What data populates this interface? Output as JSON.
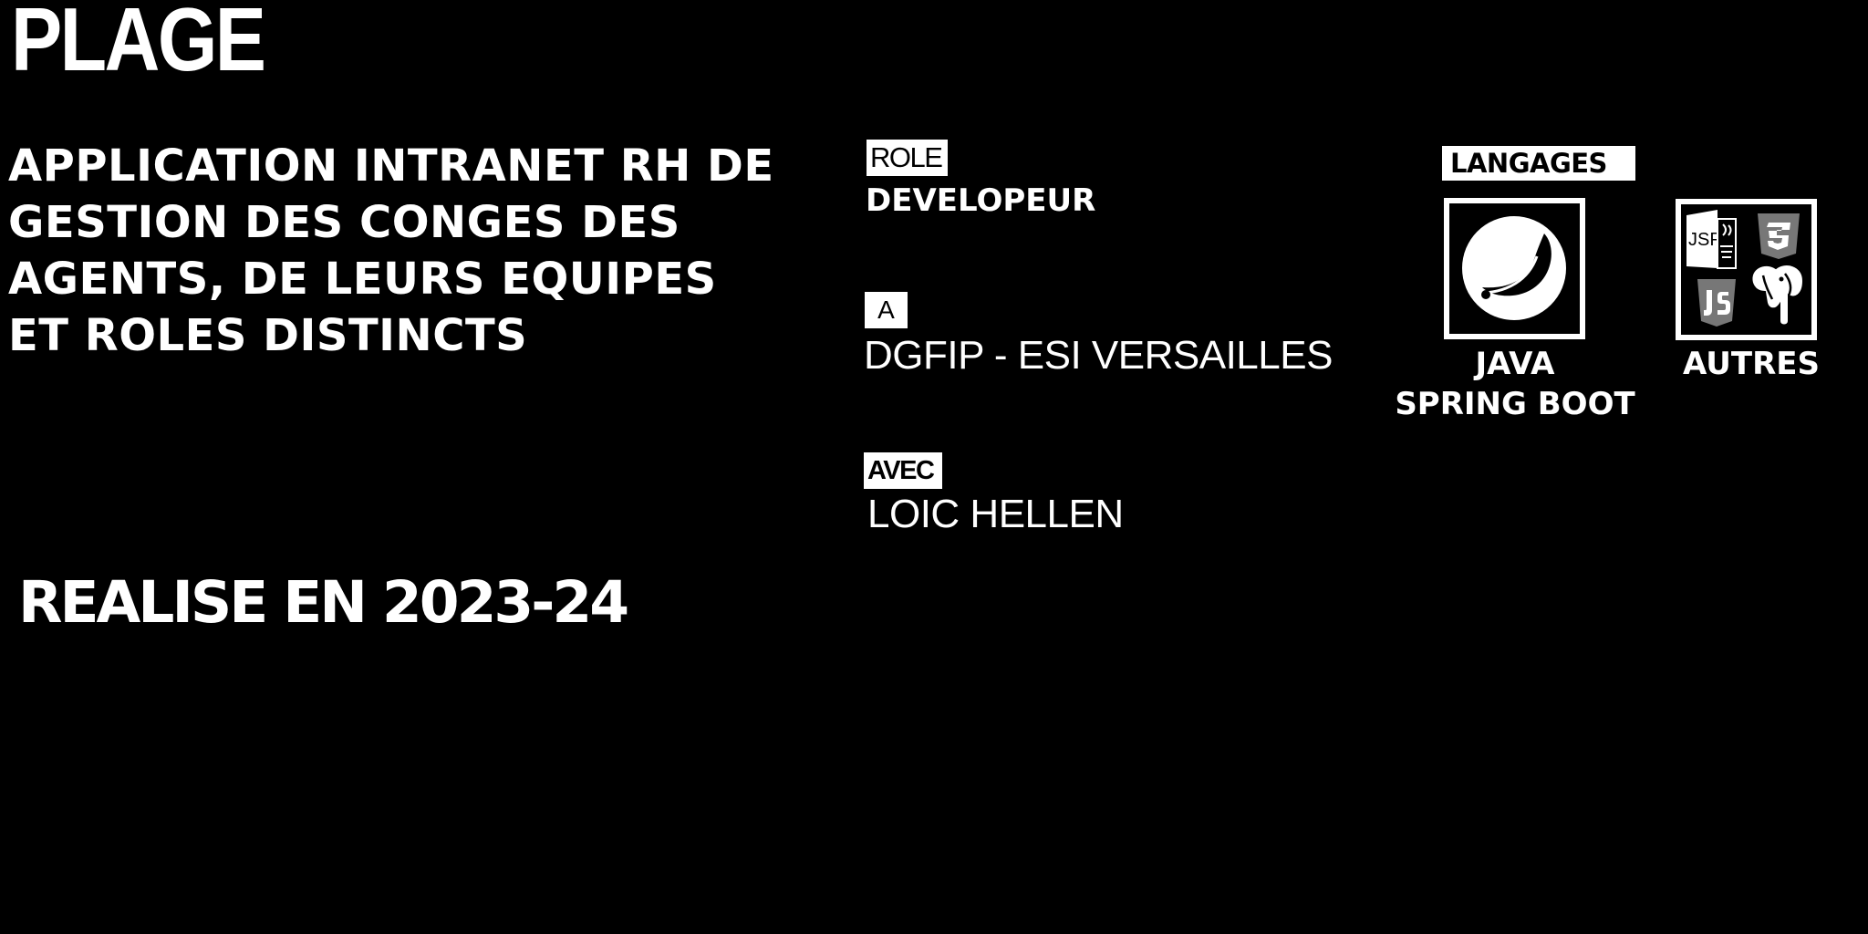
{
  "title": "PLAGE",
  "description": {
    "lines": [
      "APPLICATION INTRANET RH DE",
      "GESTION DES CONGES DES",
      "AGENTS, DE LEURS EQUIPES",
      "ET ROLES DISTINCTS"
    ]
  },
  "year_text": "REALISE EN 2023-24",
  "role": {
    "label": "ROLE",
    "value": "DEVELOPEUR"
  },
  "location": {
    "label": "A",
    "value": "DGFIP - ESI VERSAILLES"
  },
  "partner": {
    "label": "AVEC",
    "value": "LOIC HELLEN"
  },
  "languages": {
    "label": "LANGAGES",
    "items": [
      {
        "icon": "spring-leaf-icon",
        "caption_lines": [
          "JAVA",
          "SPRING BOOT"
        ]
      },
      {
        "icon": "other-languages-icon",
        "sub_icons": [
          "jsp-java-icon",
          "css3-icon",
          "javascript-icon",
          "postgresql-elephant-icon"
        ],
        "jsp_text": "JSP",
        "caption_lines": [
          "AUTRES"
        ]
      }
    ]
  }
}
